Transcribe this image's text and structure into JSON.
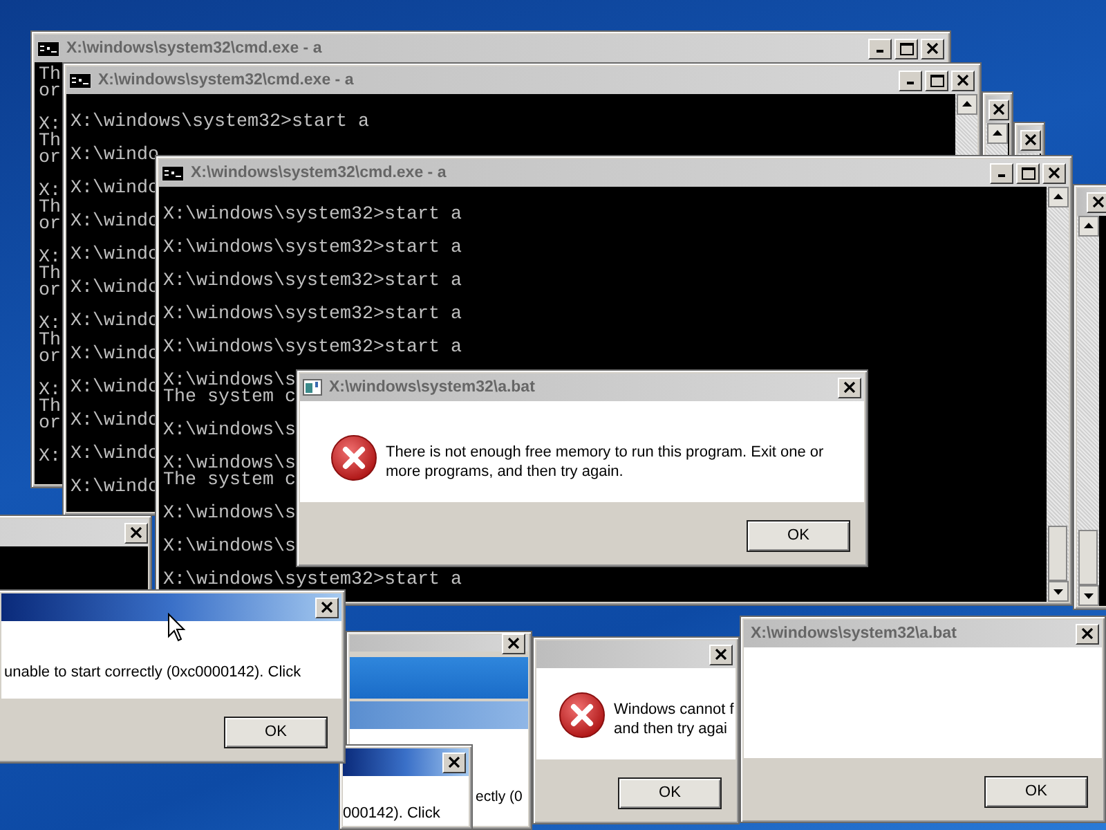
{
  "windows": [
    {
      "kind": "console",
      "title": "X:\\windows\\system32\\cmd.exe - a",
      "active": false,
      "blocks": [
        [
          "Th",
          "or"
        ],
        [
          "X:",
          "Th",
          "or"
        ],
        [
          "X:",
          "Th",
          "or"
        ],
        [
          "X:",
          "Th",
          "or"
        ],
        [
          "X:",
          "Th",
          "or"
        ],
        [
          "X:",
          "Th",
          "or"
        ],
        [
          "X:"
        ]
      ]
    },
    {
      "kind": "console",
      "active": false
    },
    {
      "kind": "console",
      "active": false
    },
    {
      "kind": "console",
      "active": false
    },
    {
      "kind": "console",
      "title": "X:\\windows\\system32\\cmd.exe - a",
      "active": false,
      "blocks": [
        [
          "X:\\windows\\system32>start a"
        ],
        [
          "X:\\windo"
        ],
        [
          "X:\\windo"
        ],
        [
          "X:\\windo"
        ],
        [
          "X:\\windo"
        ],
        [
          "X:\\windo"
        ],
        [
          "X:\\windo"
        ],
        [
          "X:\\windo"
        ],
        [
          "X:\\windo"
        ],
        [
          "X:\\windo"
        ],
        [
          "X:\\windo"
        ],
        [
          "X:\\windo"
        ]
      ]
    },
    {
      "kind": "console",
      "active": false
    },
    {
      "kind": "console",
      "title": "X:\\windows\\system32\\cmd.exe - a",
      "active": false,
      "blocks": [
        [
          "X:\\windows\\system32>start a"
        ],
        [
          "X:\\windows\\system32>start a"
        ],
        [
          "X:\\windows\\system32>start a"
        ],
        [
          "X:\\windows\\system32>start a"
        ],
        [
          "X:\\windows\\system32>start a"
        ],
        [
          "X:\\windows\\s",
          "The system c"
        ],
        [
          "X:\\windows\\s"
        ],
        [
          "X:\\windows\\s",
          "The system c"
        ],
        [
          "X:\\windows\\s"
        ],
        [
          "X:\\windows\\s"
        ],
        [
          "X:\\windows\\system32>start a"
        ]
      ]
    },
    {
      "kind": "explorer",
      "active": false,
      "lines": [
        "ectly (0"
      ]
    },
    {
      "kind": "dialog",
      "active": true,
      "lines": [
        "000142). Click"
      ]
    },
    {
      "kind": "dialog",
      "active": true,
      "lines": [
        "unable to start correctly (0xc0000142). Click"
      ],
      "buttons": [
        "OK"
      ]
    },
    {
      "kind": "error",
      "title": "X:\\windows\\system32\\a.bat",
      "active": false,
      "lines": [
        "There is not enough free memory to run this program. Exit one or",
        "more programs, and then try again."
      ],
      "buttons": [
        "OK"
      ]
    },
    {
      "kind": "error",
      "active": false,
      "lines": [
        "Windows cannot f",
        "and then try agai"
      ],
      "buttons": [
        "OK"
      ]
    },
    {
      "kind": "dialog",
      "title": "X:\\windows\\system32\\a.bat",
      "active": false,
      "buttons": [
        "OK"
      ]
    }
  ]
}
